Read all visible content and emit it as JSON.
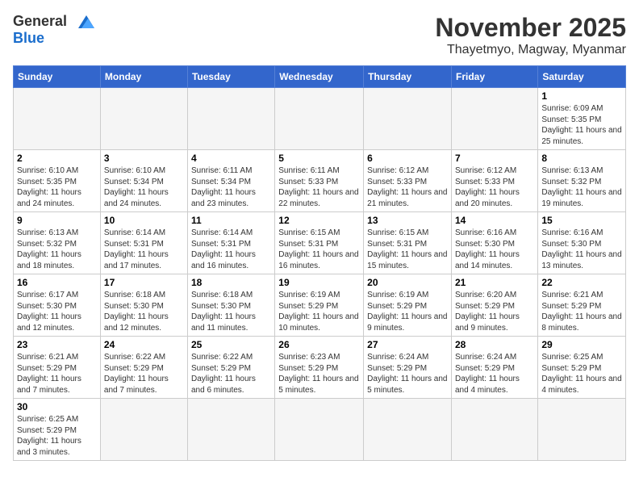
{
  "header": {
    "logo_general": "General",
    "logo_blue": "Blue",
    "month_title": "November 2025",
    "location": "Thayetmyo, Magway, Myanmar"
  },
  "weekdays": [
    "Sunday",
    "Monday",
    "Tuesday",
    "Wednesday",
    "Thursday",
    "Friday",
    "Saturday"
  ],
  "days": {
    "d1": {
      "num": "1",
      "sunrise": "6:09 AM",
      "sunset": "5:35 PM",
      "daylight": "11 hours and 25 minutes."
    },
    "d2": {
      "num": "2",
      "sunrise": "6:10 AM",
      "sunset": "5:35 PM",
      "daylight": "11 hours and 24 minutes."
    },
    "d3": {
      "num": "3",
      "sunrise": "6:10 AM",
      "sunset": "5:34 PM",
      "daylight": "11 hours and 24 minutes."
    },
    "d4": {
      "num": "4",
      "sunrise": "6:11 AM",
      "sunset": "5:34 PM",
      "daylight": "11 hours and 23 minutes."
    },
    "d5": {
      "num": "5",
      "sunrise": "6:11 AM",
      "sunset": "5:33 PM",
      "daylight": "11 hours and 22 minutes."
    },
    "d6": {
      "num": "6",
      "sunrise": "6:12 AM",
      "sunset": "5:33 PM",
      "daylight": "11 hours and 21 minutes."
    },
    "d7": {
      "num": "7",
      "sunrise": "6:12 AM",
      "sunset": "5:33 PM",
      "daylight": "11 hours and 20 minutes."
    },
    "d8": {
      "num": "8",
      "sunrise": "6:13 AM",
      "sunset": "5:32 PM",
      "daylight": "11 hours and 19 minutes."
    },
    "d9": {
      "num": "9",
      "sunrise": "6:13 AM",
      "sunset": "5:32 PM",
      "daylight": "11 hours and 18 minutes."
    },
    "d10": {
      "num": "10",
      "sunrise": "6:14 AM",
      "sunset": "5:31 PM",
      "daylight": "11 hours and 17 minutes."
    },
    "d11": {
      "num": "11",
      "sunrise": "6:14 AM",
      "sunset": "5:31 PM",
      "daylight": "11 hours and 16 minutes."
    },
    "d12": {
      "num": "12",
      "sunrise": "6:15 AM",
      "sunset": "5:31 PM",
      "daylight": "11 hours and 16 minutes."
    },
    "d13": {
      "num": "13",
      "sunrise": "6:15 AM",
      "sunset": "5:31 PM",
      "daylight": "11 hours and 15 minutes."
    },
    "d14": {
      "num": "14",
      "sunrise": "6:16 AM",
      "sunset": "5:30 PM",
      "daylight": "11 hours and 14 minutes."
    },
    "d15": {
      "num": "15",
      "sunrise": "6:16 AM",
      "sunset": "5:30 PM",
      "daylight": "11 hours and 13 minutes."
    },
    "d16": {
      "num": "16",
      "sunrise": "6:17 AM",
      "sunset": "5:30 PM",
      "daylight": "11 hours and 12 minutes."
    },
    "d17": {
      "num": "17",
      "sunrise": "6:18 AM",
      "sunset": "5:30 PM",
      "daylight": "11 hours and 12 minutes."
    },
    "d18": {
      "num": "18",
      "sunrise": "6:18 AM",
      "sunset": "5:30 PM",
      "daylight": "11 hours and 11 minutes."
    },
    "d19": {
      "num": "19",
      "sunrise": "6:19 AM",
      "sunset": "5:29 PM",
      "daylight": "11 hours and 10 minutes."
    },
    "d20": {
      "num": "20",
      "sunrise": "6:19 AM",
      "sunset": "5:29 PM",
      "daylight": "11 hours and 9 minutes."
    },
    "d21": {
      "num": "21",
      "sunrise": "6:20 AM",
      "sunset": "5:29 PM",
      "daylight": "11 hours and 9 minutes."
    },
    "d22": {
      "num": "22",
      "sunrise": "6:21 AM",
      "sunset": "5:29 PM",
      "daylight": "11 hours and 8 minutes."
    },
    "d23": {
      "num": "23",
      "sunrise": "6:21 AM",
      "sunset": "5:29 PM",
      "daylight": "11 hours and 7 minutes."
    },
    "d24": {
      "num": "24",
      "sunrise": "6:22 AM",
      "sunset": "5:29 PM",
      "daylight": "11 hours and 7 minutes."
    },
    "d25": {
      "num": "25",
      "sunrise": "6:22 AM",
      "sunset": "5:29 PM",
      "daylight": "11 hours and 6 minutes."
    },
    "d26": {
      "num": "26",
      "sunrise": "6:23 AM",
      "sunset": "5:29 PM",
      "daylight": "11 hours and 5 minutes."
    },
    "d27": {
      "num": "27",
      "sunrise": "6:24 AM",
      "sunset": "5:29 PM",
      "daylight": "11 hours and 5 minutes."
    },
    "d28": {
      "num": "28",
      "sunrise": "6:24 AM",
      "sunset": "5:29 PM",
      "daylight": "11 hours and 4 minutes."
    },
    "d29": {
      "num": "29",
      "sunrise": "6:25 AM",
      "sunset": "5:29 PM",
      "daylight": "11 hours and 4 minutes."
    },
    "d30": {
      "num": "30",
      "sunrise": "6:25 AM",
      "sunset": "5:29 PM",
      "daylight": "11 hours and 3 minutes."
    }
  },
  "labels": {
    "sunrise": "Sunrise:",
    "sunset": "Sunset:",
    "daylight": "Daylight:"
  }
}
